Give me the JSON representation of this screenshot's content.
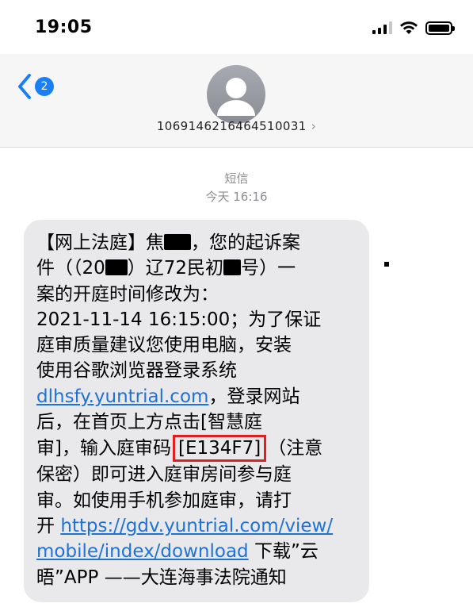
{
  "status_bar": {
    "time": "19:05"
  },
  "header": {
    "back_badge": "2",
    "contact_number": "1069146216464510031",
    "chevron": "›"
  },
  "thread": {
    "service": "短信",
    "date": "今天 16:16"
  },
  "message": {
    "l1a": "【网上法庭】焦",
    "l1b": "，您的起诉案",
    "l2a": "件（（20",
    "l2b": "）辽72民初",
    "l2c": "号）一",
    "l3": "案的开庭时间修改为：",
    "l4": "2021-11-14 16:15:00；为了保证",
    "l5": "庭审质量建议您使用电脑，安装",
    "l6": "使用谷歌浏览器登录系统",
    "link1": "dlhsfy.yuntrial.com",
    "l7b": "，登录网站",
    "l8": "后，在首页上方点击[智慧庭",
    "l9a": "审]，输入庭审码",
    "code": "[E134F7]",
    "l9b": "（注意",
    "l10": "保密）即可进入庭审房间参与庭",
    "l11": "审。如使用手机参加庭审，请打",
    "l12a": "开 ",
    "link2a": "https://gdv.yuntrial.com/view/",
    "link2b": "mobile/index/download",
    "l13b": " 下载”云",
    "l14": "晤”APP ——大连海事法院通知"
  },
  "colors": {
    "link": "#1f72d9",
    "badge": "#1a7ef5",
    "highlight": "#e02020",
    "bubble": "#e9e9eb"
  }
}
